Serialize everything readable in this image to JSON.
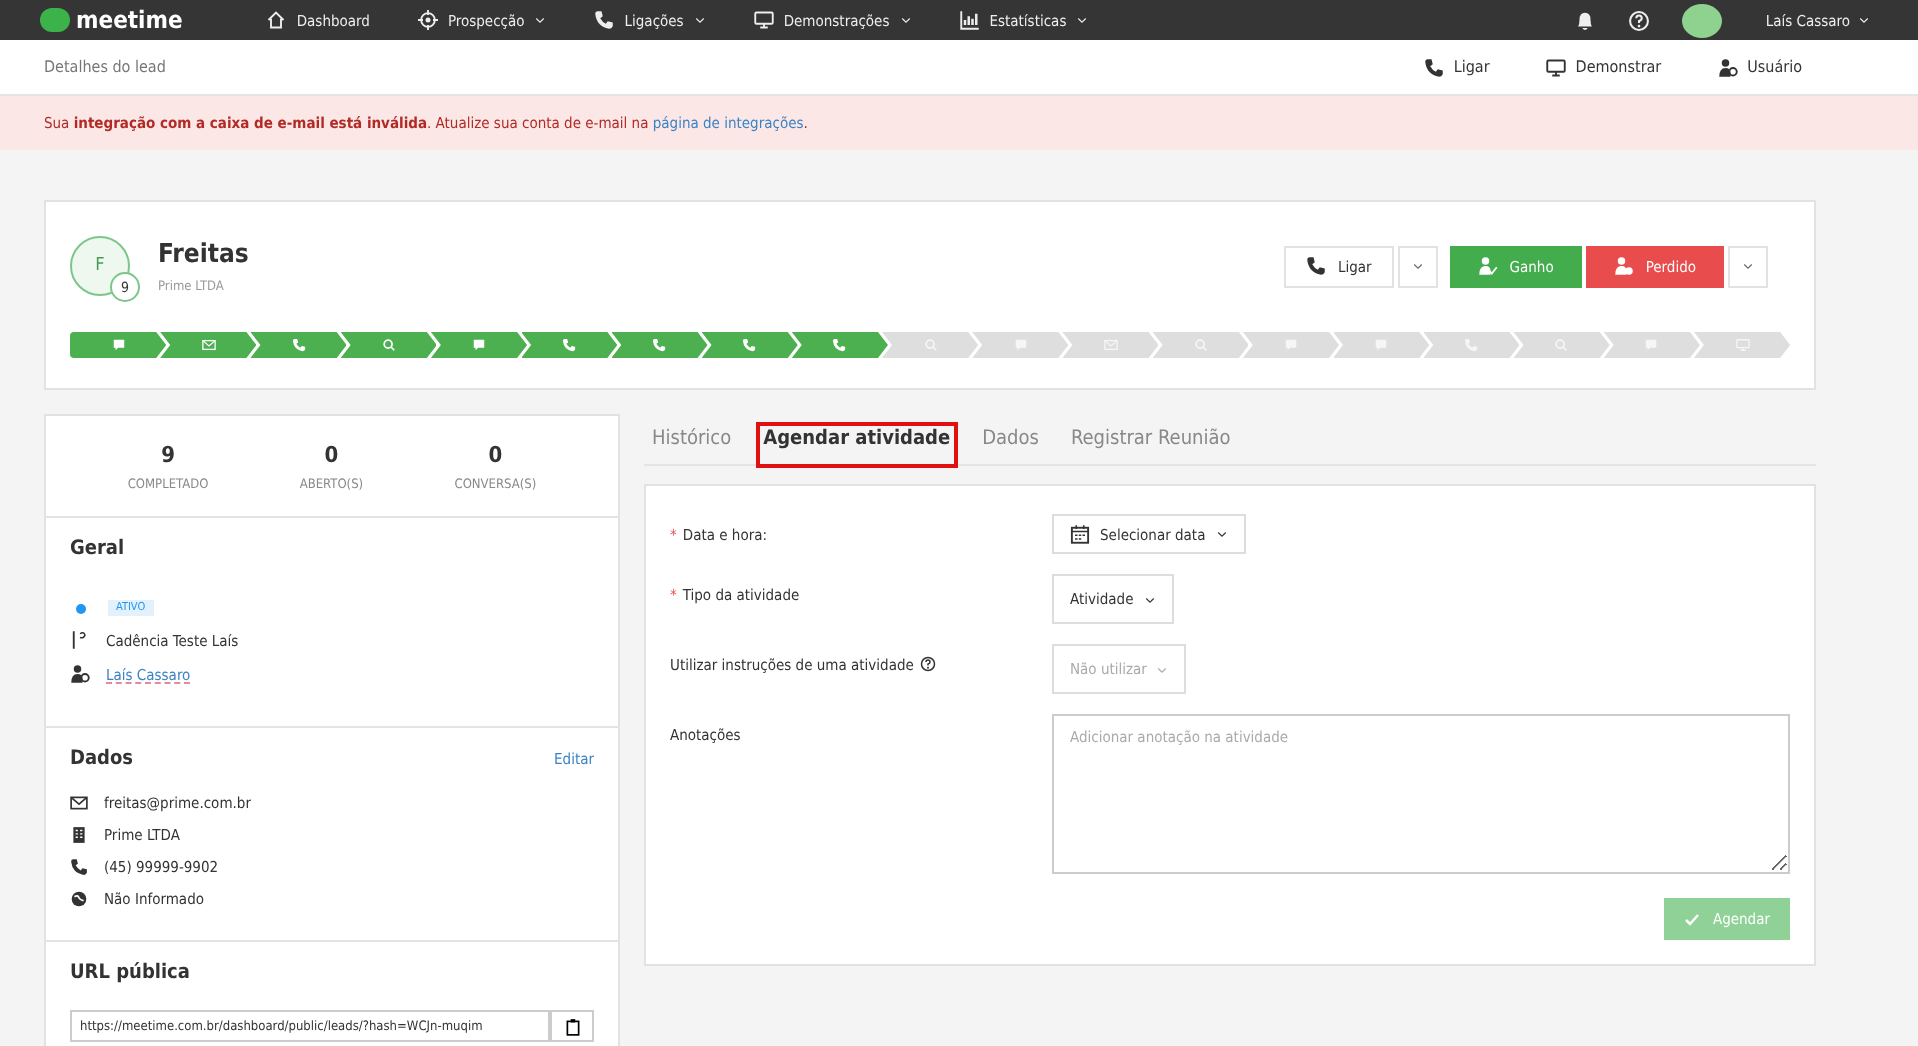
{
  "topbar": {
    "logo": "meetime",
    "nav": [
      {
        "label": "Dashboard",
        "kind": "home",
        "dropdown": false
      },
      {
        "label": "Prospecção",
        "kind": "target",
        "dropdown": true
      },
      {
        "label": "Ligações",
        "kind": "phone",
        "dropdown": true
      },
      {
        "label": "Demonstrações",
        "kind": "screen",
        "dropdown": true
      },
      {
        "label": "Estatísticas",
        "kind": "chart",
        "dropdown": true
      }
    ],
    "user": "Laís Cassaro"
  },
  "subheader": {
    "title": "Detalhes do lead",
    "actions": [
      {
        "label": "Ligar",
        "kind": "phone"
      },
      {
        "label": "Demonstrar",
        "kind": "screen"
      },
      {
        "label": "Usuário",
        "kind": "user"
      }
    ]
  },
  "alert": {
    "text": "Sua **integração com a caixa de e-mail está inválida**. Atualize sua conta de e-mail na",
    "link": "página de integrações",
    "end": "."
  },
  "lead": {
    "initial": "F",
    "badge": "9",
    "name": "Freitas",
    "company": "Prime LTDA",
    "buttons": [
      {
        "label": "Ligar",
        "kind": "default"
      },
      {
        "label": "Ganho",
        "kind": "success"
      },
      {
        "label": "Perdido",
        "kind": "danger"
      }
    ],
    "stages": [
      {
        "kind": "chat",
        "done": true
      },
      {
        "kind": "mail",
        "done": true
      },
      {
        "kind": "phone",
        "done": true
      },
      {
        "kind": "search",
        "done": true
      },
      {
        "kind": "chat",
        "done": true
      },
      {
        "kind": "phone",
        "done": true
      },
      {
        "kind": "phone",
        "done": true
      },
      {
        "kind": "phone",
        "done": true
      },
      {
        "kind": "phone",
        "done": true
      },
      {
        "kind": "search",
        "done": false
      },
      {
        "kind": "chat",
        "done": false
      },
      {
        "kind": "mail",
        "done": false
      },
      {
        "kind": "search",
        "done": false
      },
      {
        "kind": "chat",
        "done": false
      },
      {
        "kind": "chat",
        "done": false
      },
      {
        "kind": "phone",
        "done": false
      },
      {
        "kind": "search",
        "done": false
      },
      {
        "kind": "chat",
        "done": false
      },
      {
        "kind": "screen",
        "done": false
      }
    ]
  },
  "stats": [
    {
      "value": "9",
      "label": "COMPLETADO"
    },
    {
      "value": "0",
      "label": "ABERTO(S)"
    },
    {
      "value": "0",
      "label": "CONVERSA(S)"
    }
  ],
  "geral": {
    "title": "Geral",
    "status": "ATIVO",
    "cadence": "Cadência Teste Laís",
    "owner": "Laís Cassaro"
  },
  "dados": {
    "title": "Dados",
    "edit": "Editar",
    "items": [
      {
        "kind": "mail",
        "text": "freitas@prime.com.br"
      },
      {
        "kind": "building",
        "text": "Prime LTDA"
      },
      {
        "kind": "phone",
        "text": "(45) 99999-9902"
      },
      {
        "kind": "globe",
        "text": "Não Informado"
      }
    ]
  },
  "url": {
    "title": "URL pública",
    "value": "https://meetime.com.br/dashboard/public/leads/?hash=WCJn-muqim"
  },
  "tabs": [
    {
      "label": "Histórico",
      "selected": false,
      "highlighted": false
    },
    {
      "label": "Agendar atividade",
      "selected": true,
      "highlighted": true
    },
    {
      "label": "Dados",
      "selected": false,
      "highlighted": false
    },
    {
      "label": "Registrar Reunião",
      "selected": false,
      "highlighted": false
    }
  ],
  "form": {
    "fields": [
      {
        "marker": "*",
        "label": "Data e hora:",
        "kind": "date",
        "value": "Selecionar data"
      },
      {
        "marker": "*",
        "label": "Tipo da atividade",
        "kind": "select",
        "value": "Atividade"
      },
      {
        "label": "Utilizar instruções de uma atividade",
        "help": true,
        "kind": "select-muted",
        "value": "Não utilizar"
      },
      {
        "label": "Anotações",
        "kind": "textarea",
        "placeholder": "Adicionar anotação na atividade"
      }
    ],
    "submit": {
      "label": "Agendar",
      "disabled": true
    }
  }
}
